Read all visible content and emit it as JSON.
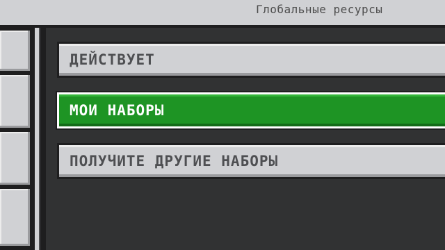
{
  "header": {
    "title": "Глобальные ресурсы"
  },
  "sidebar": {
    "tabs": [
      "",
      "",
      "",
      ""
    ]
  },
  "menu": {
    "items": [
      {
        "label": "ДЕЙСТВУЕТ",
        "selected": false
      },
      {
        "label": "МОИ НАБОРЫ",
        "selected": true
      },
      {
        "label": "ПОЛУЧИТЕ ДРУГИЕ НАБОРЫ",
        "selected": false
      }
    ]
  },
  "colors": {
    "accent": "#1e9424",
    "button": "#d0d1d4",
    "panel": "#313233",
    "frame": "#1e1e1f"
  }
}
